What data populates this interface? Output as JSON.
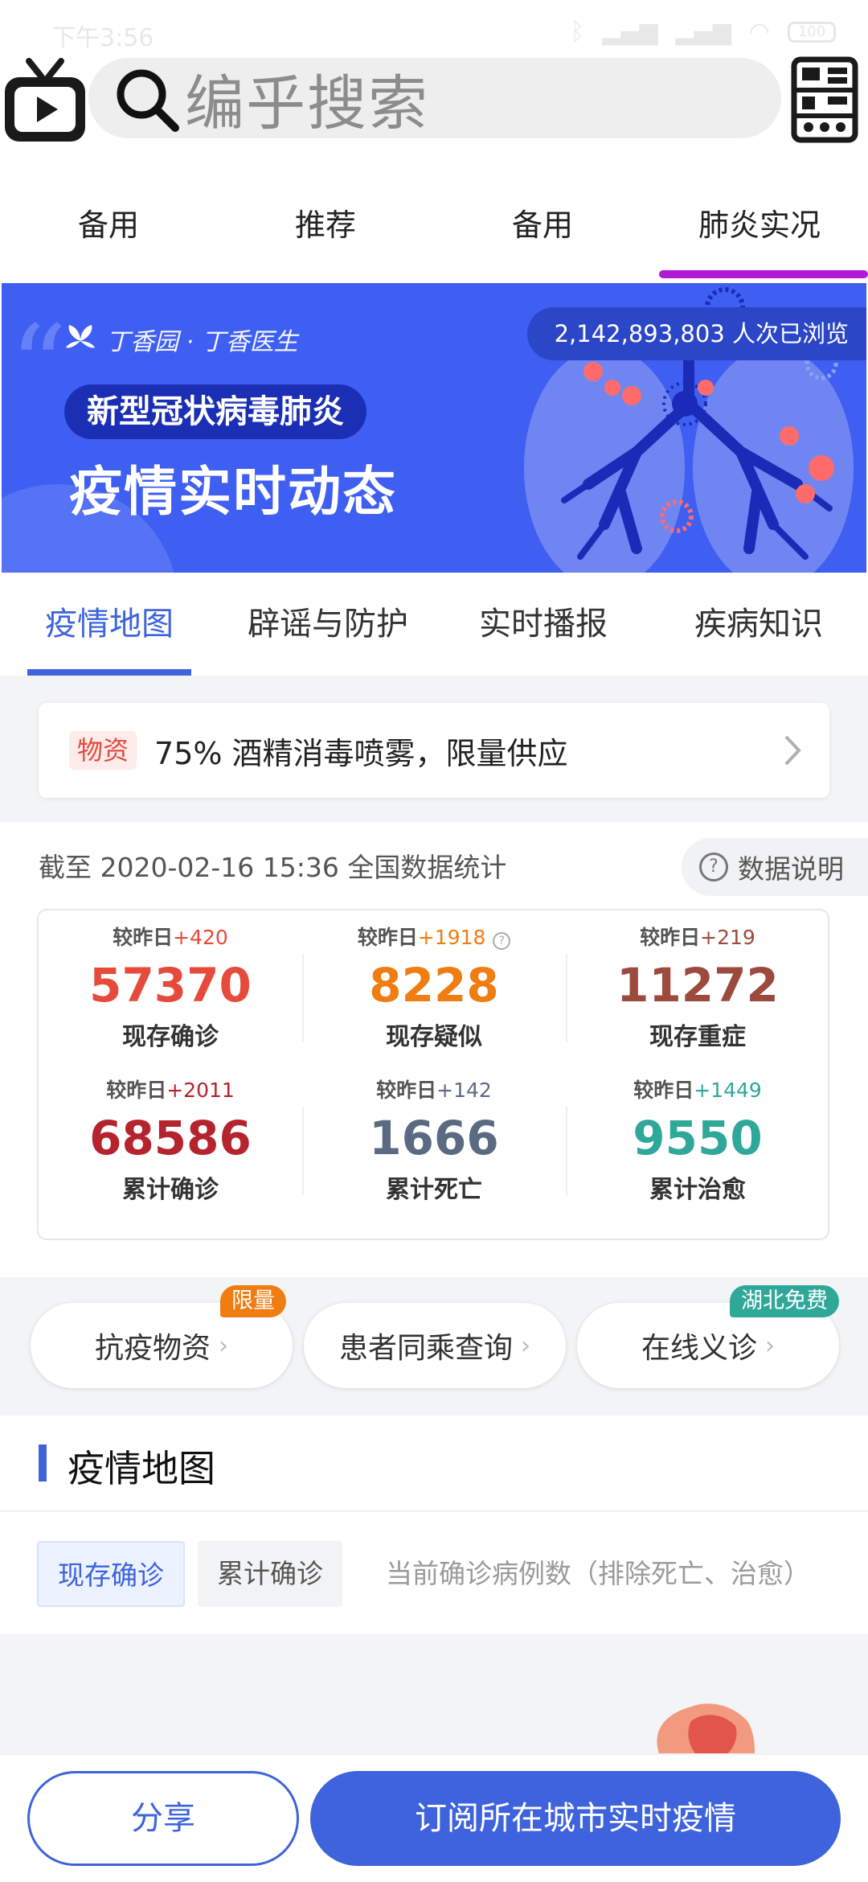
{
  "status_bar": {
    "time": "下午3:56",
    "battery": "100"
  },
  "search": {
    "placeholder": "编乎搜索"
  },
  "channel_tabs": [
    {
      "label": "备用"
    },
    {
      "label": "推荐"
    },
    {
      "label": "备用"
    },
    {
      "label": "肺炎实况"
    }
  ],
  "banner": {
    "brand": "丁香园 · 丁香医生",
    "pill": "新型冠状病毒肺炎",
    "headline": "疫情实时动态",
    "views": "2,142,893,803 人次已浏览"
  },
  "section_tabs": [
    {
      "label": "疫情地图"
    },
    {
      "label": "辟谣与防护"
    },
    {
      "label": "实时播报"
    },
    {
      "label": "疾病知识"
    }
  ],
  "notice": {
    "tag": "物资",
    "text": "75% 酒精消毒喷雾，限量供应"
  },
  "stats": {
    "header": "截至 2020-02-16 15:36 全国数据统计",
    "data_note": "数据说明",
    "delta_prefix": "较昨日",
    "items": [
      {
        "delta": "+420",
        "value": "57370",
        "label": "现存确诊",
        "color": "#e64a3b"
      },
      {
        "delta": "+1918",
        "value": "8228",
        "label": "现存疑似",
        "color": "#ef7d12"
      },
      {
        "delta": "+219",
        "value": "11272",
        "label": "现存重症",
        "color": "#9c4a3e"
      },
      {
        "delta": "+2011",
        "value": "68586",
        "label": "累计确诊",
        "color": "#b5232e"
      },
      {
        "delta": "+142",
        "value": "1666",
        "label": "累计死亡",
        "color": "#5b6a83"
      },
      {
        "delta": "+1449",
        "value": "9550",
        "label": "累计治愈",
        "color": "#2fa89a"
      }
    ]
  },
  "entries": [
    {
      "label": "抗疫物资",
      "badge": "限量",
      "badge_color": "#ef7d12"
    },
    {
      "label": "患者同乘查询",
      "badge": "",
      "badge_color": ""
    },
    {
      "label": "在线义诊",
      "badge": "湖北免费",
      "badge_color": "#2fa89a"
    }
  ],
  "map_section": {
    "title": "疫情地图",
    "tab_active": "现存确诊",
    "tab_inactive": "累计确诊",
    "description": "当前确诊病例数（排除死亡、治愈）"
  },
  "bottom": {
    "share": "分享",
    "subscribe": "订阅所在城市实时疫情"
  }
}
